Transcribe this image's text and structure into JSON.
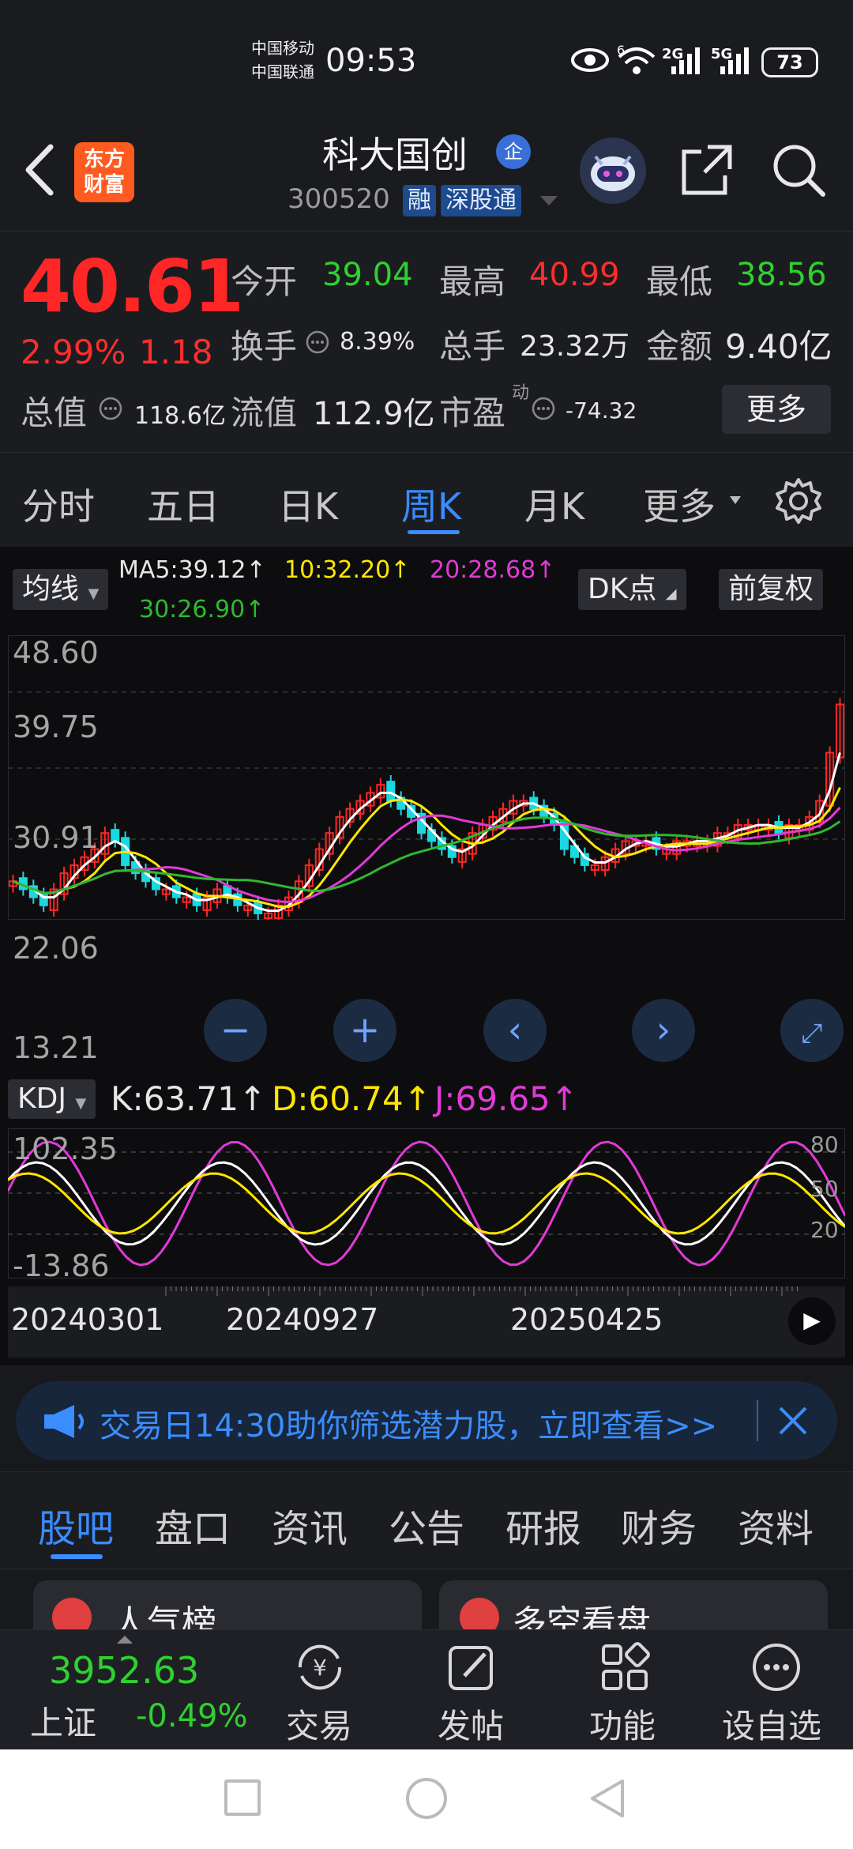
{
  "status_bar": {
    "carrier1": "中国移动",
    "carrier2": "中国联通",
    "time": "09:53",
    "signal1": "6",
    "signal2": "2G",
    "signal3": "5G",
    "battery": "73"
  },
  "header": {
    "app_logo": "东方\n财富",
    "app_logo_line1": "东方",
    "app_logo_line2": "财富",
    "stock_name": "科大国创",
    "name_badge": "企",
    "stock_code": "300520",
    "tag_margin": "融",
    "tag_connect": "深股通"
  },
  "quote": {
    "price": "40.61",
    "change_pct": "2.99%",
    "change_amt": "1.18",
    "open_label": "今开",
    "open": "39.04",
    "high_label": "最高",
    "high": "40.99",
    "low_label": "最低",
    "low": "38.56",
    "turnover_label": "换手",
    "turnover": "8.39%",
    "volume_label": "总手",
    "volume": "23.32万",
    "amount_label": "金额",
    "amount": "9.40亿",
    "mktcap_label": "总值",
    "mktcap": "118.6亿",
    "float_label": "流值",
    "float": "112.9亿",
    "pe_label": "市盈",
    "pe_sup": "动",
    "pe": "-74.32",
    "more": "更多"
  },
  "period_tabs": [
    "分时",
    "五日",
    "日K",
    "周K",
    "月K",
    "更多"
  ],
  "chart": {
    "ma_button": "均线",
    "ma5": "MA5:39.12↑",
    "ma10": "10:32.20↑",
    "ma20": "20:28.68↑",
    "ma30": "30:26.90↑",
    "dk_button": "DK点",
    "adjust_button": "前复权",
    "y_labels": [
      "48.60",
      "39.75",
      "30.91",
      "22.06",
      "13.21"
    ],
    "kdj_button": "KDJ",
    "k": "K:63.71↑",
    "d": "D:60.74↑",
    "j": "J:69.65↑",
    "kdj_y_top": "102.35",
    "kdj_y_bottom": "-13.86",
    "kdj_ref_80": "80",
    "kdj_ref_50": "50",
    "kdj_ref_20": "20",
    "dates": [
      "20240301",
      "20240927",
      "20250425"
    ]
  },
  "chart_data": {
    "type": "candlestick",
    "title": "",
    "ylim": [
      13.21,
      48.6
    ],
    "close_last": 40.61,
    "ma_last": {
      "MA5": 39.12,
      "MA10": 32.2,
      "MA20": 28.68,
      "MA30": 26.9
    },
    "kdj_last": {
      "K": 63.71,
      "D": 60.74,
      "J": 69.65
    },
    "x_ticks": [
      "20240301",
      "20240927",
      "20250425"
    ]
  },
  "banner": {
    "text": "交易日14:30助你筛选潜力股，立即查看>>"
  },
  "sub_tabs": [
    "股吧",
    "盘口",
    "资讯",
    "公告",
    "研报",
    "财务",
    "资料"
  ],
  "cards": {
    "left": "人气榜",
    "right": "多空看盘"
  },
  "bottom_nav": {
    "index_value": "3952.63",
    "index_name": "上证",
    "index_change": "-0.49%",
    "trade": "交易",
    "post": "发帖",
    "functions": "功能",
    "watchlist": "设自选"
  },
  "colors": {
    "up": "#ff2626",
    "down": "#2fd12f",
    "accent": "#3a8cff",
    "ma5": "#ffffff",
    "ma10": "#ffe600",
    "ma20": "#e23ad8",
    "ma30": "#2fb82f"
  }
}
